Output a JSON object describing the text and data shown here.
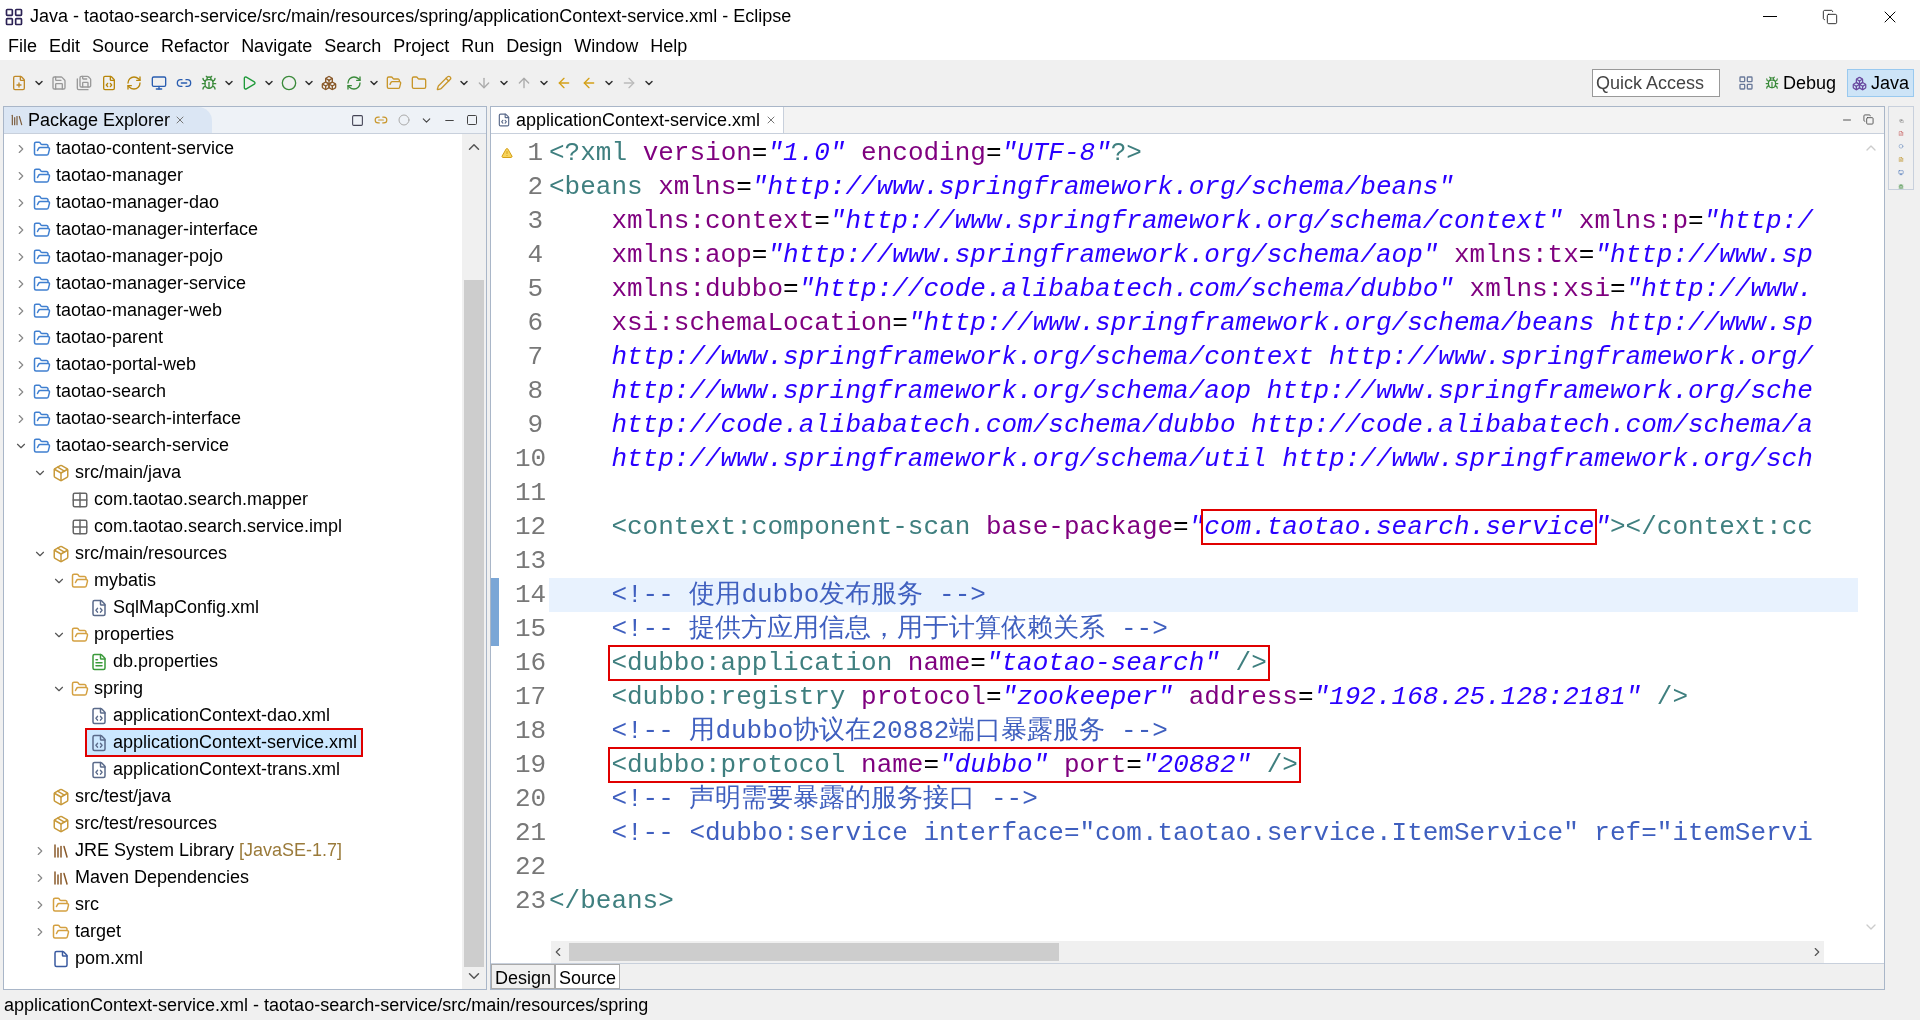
{
  "window": {
    "title": "Java - taotao-search-service/src/main/resources/spring/applicationContext-service.xml - Eclipse"
  },
  "menu": [
    "File",
    "Edit",
    "Source",
    "Refactor",
    "Navigate",
    "Search",
    "Project",
    "Run",
    "Design",
    "Window",
    "Help"
  ],
  "quick_access": {
    "placeholder": "Quick Access"
  },
  "perspectives": [
    {
      "label": "Debug",
      "selected": false
    },
    {
      "label": "Java",
      "selected": true
    }
  ],
  "package_explorer": {
    "title": "Package Explorer",
    "tree": [
      {
        "label": "taotao-content-service",
        "kind": "project",
        "expanded": false,
        "selected": false
      },
      {
        "label": "taotao-manager",
        "kind": "project",
        "expanded": false,
        "selected": false
      },
      {
        "label": "taotao-manager-dao",
        "kind": "project",
        "expanded": false,
        "selected": false
      },
      {
        "label": "taotao-manager-interface",
        "kind": "project",
        "expanded": false,
        "selected": false
      },
      {
        "label": "taotao-manager-pojo",
        "kind": "project",
        "expanded": false,
        "selected": false
      },
      {
        "label": "taotao-manager-service",
        "kind": "project",
        "expanded": false,
        "selected": false
      },
      {
        "label": "taotao-manager-web",
        "kind": "project",
        "expanded": false,
        "selected": false
      },
      {
        "label": "taotao-parent",
        "kind": "project",
        "expanded": false,
        "selected": false
      },
      {
        "label": "taotao-portal-web",
        "kind": "project",
        "expanded": false,
        "selected": false
      },
      {
        "label": "taotao-search",
        "kind": "project",
        "expanded": false,
        "selected": false
      },
      {
        "label": "taotao-search-interface",
        "kind": "project",
        "expanded": false,
        "selected": false
      },
      {
        "label": "taotao-search-service",
        "kind": "project",
        "expanded": true,
        "selected": false,
        "children": [
          {
            "label": "src/main/java",
            "kind": "sourcefolder",
            "expanded": true,
            "selected": false,
            "children": [
              {
                "label": "com.taotao.search.mapper",
                "kind": "package",
                "selected": false
              },
              {
                "label": "com.taotao.search.service.impl",
                "kind": "package",
                "selected": false
              }
            ]
          },
          {
            "label": "src/main/resources",
            "kind": "sourcefolder",
            "expanded": true,
            "selected": false,
            "children": [
              {
                "label": "mybatis",
                "kind": "folder",
                "expanded": true,
                "selected": false,
                "children": [
                  {
                    "label": "SqlMapConfig.xml",
                    "kind": "xml",
                    "selected": false
                  }
                ]
              },
              {
                "label": "properties",
                "kind": "folder",
                "expanded": true,
                "selected": false,
                "children": [
                  {
                    "label": "db.properties",
                    "kind": "properties",
                    "selected": false
                  }
                ]
              },
              {
                "label": "spring",
                "kind": "folder",
                "expanded": true,
                "selected": false,
                "children": [
                  {
                    "label": "applicationContext-dao.xml",
                    "kind": "xml",
                    "selected": false
                  },
                  {
                    "label": "applicationContext-service.xml",
                    "kind": "xml",
                    "selected": true,
                    "boxed": true
                  },
                  {
                    "label": "applicationContext-trans.xml",
                    "kind": "xml",
                    "selected": false
                  }
                ]
              }
            ]
          },
          {
            "label": "src/test/java",
            "kind": "sourcefolder",
            "selected": false
          },
          {
            "label": "src/test/resources",
            "kind": "sourcefolder",
            "selected": false
          },
          {
            "label": "JRE System Library",
            "detail": "[JavaSE-1.7]",
            "kind": "library",
            "expanded": false,
            "selected": false
          },
          {
            "label": "Maven Dependencies",
            "kind": "library",
            "expanded": false,
            "selected": false
          },
          {
            "label": "src",
            "kind": "folder",
            "expanded": false,
            "selected": false
          },
          {
            "label": "target",
            "kind": "folder",
            "expanded": false,
            "selected": false
          },
          {
            "label": "pom.xml",
            "kind": "pom",
            "selected": false
          }
        ]
      }
    ]
  },
  "editor": {
    "tab": "applicationContext-service.xml",
    "lines": [
      {
        "number": "1",
        "kind": "warning",
        "indented": false,
        "current": false,
        "tokens": [
          {
            "kind": "tag",
            "text": "<?xml "
          },
          {
            "kind": "attr",
            "text": "version"
          },
          {
            "kind": "eq",
            "text": "="
          },
          {
            "kind": "value",
            "text": "\"1.0\" "
          },
          {
            "kind": "attr",
            "text": "encoding"
          },
          {
            "kind": "eq",
            "text": "="
          },
          {
            "kind": "value",
            "text": "\"UTF-8\""
          },
          {
            "kind": "tag",
            "text": "?>"
          }
        ]
      },
      {
        "number": "2",
        "kind": "plain",
        "indented": false,
        "current": false,
        "tokens": [
          {
            "kind": "tag",
            "text": "<beans "
          },
          {
            "kind": "attr",
            "text": "xmlns"
          },
          {
            "kind": "eq",
            "text": "="
          },
          {
            "kind": "value",
            "text": "\"http://www.springframework.org/schema/beans\""
          }
        ]
      },
      {
        "number": "3",
        "kind": "plain",
        "indented": true,
        "current": false,
        "tokens": [
          {
            "kind": "attr",
            "text": "xmlns:context"
          },
          {
            "kind": "eq",
            "text": "="
          },
          {
            "kind": "value",
            "text": "\"http://www.springframework.org/schema/context\" "
          },
          {
            "kind": "attr",
            "text": "xmlns:p"
          },
          {
            "kind": "eq",
            "text": "="
          },
          {
            "kind": "value",
            "text": "\"http:/"
          }
        ]
      },
      {
        "number": "4",
        "kind": "plain",
        "indented": true,
        "current": false,
        "tokens": [
          {
            "kind": "attr",
            "text": "xmlns:aop"
          },
          {
            "kind": "eq",
            "text": "="
          },
          {
            "kind": "value",
            "text": "\"http://www.springframework.org/schema/aop\" "
          },
          {
            "kind": "attr",
            "text": "xmlns:tx"
          },
          {
            "kind": "eq",
            "text": "="
          },
          {
            "kind": "value",
            "text": "\"http://www.sp"
          }
        ]
      },
      {
        "number": "5",
        "kind": "plain",
        "indented": true,
        "current": false,
        "tokens": [
          {
            "kind": "attr",
            "text": "xmlns:dubbo"
          },
          {
            "kind": "eq",
            "text": "="
          },
          {
            "kind": "value",
            "text": "\"http://code.alibabatech.com/schema/dubbo\" "
          },
          {
            "kind": "attr",
            "text": "xmlns:xsi"
          },
          {
            "kind": "eq",
            "text": "="
          },
          {
            "kind": "value",
            "text": "\"http://www."
          }
        ]
      },
      {
        "number": "6",
        "kind": "plain",
        "indented": true,
        "current": false,
        "tokens": [
          {
            "kind": "attr",
            "text": "xsi:schemaLocation"
          },
          {
            "kind": "eq",
            "text": "="
          },
          {
            "kind": "value",
            "text": "\"http://www.springframework.org/schema/beans http://www.sp"
          }
        ]
      },
      {
        "number": "7",
        "kind": "plain",
        "indented": true,
        "current": false,
        "tokens": [
          {
            "kind": "value",
            "text": "http://www.springframework.org/schema/context http://www.springframework.org/"
          }
        ]
      },
      {
        "number": "8",
        "kind": "plain",
        "indented": true,
        "current": false,
        "tokens": [
          {
            "kind": "value",
            "text": "http://www.springframework.org/schema/aop http://www.springframework.org/sche"
          }
        ]
      },
      {
        "number": "9",
        "kind": "plain",
        "indented": true,
        "current": false,
        "tokens": [
          {
            "kind": "value",
            "text": "http://code.alibabatech.com/schema/dubbo http://code.alibabatech.com/schema/a"
          }
        ]
      },
      {
        "number": "10",
        "kind": "plain",
        "indented": true,
        "current": false,
        "tokens": [
          {
            "kind": "value",
            "text": "http://www.springframework.org/schema/util http://www.springframework.org/sch"
          }
        ]
      },
      {
        "number": "11",
        "kind": "plain",
        "current": false
      },
      {
        "number": "12",
        "kind": "plain",
        "indented": true,
        "current": false,
        "tokens": [
          {
            "kind": "tag",
            "text": "<context:component-scan "
          },
          {
            "kind": "attr",
            "text": "base-package"
          },
          {
            "kind": "eq",
            "text": "="
          },
          {
            "kind": "value",
            "text": "\""
          }
        ],
        "highlighted": [
          {
            "kind": "value",
            "text": "com.taotao.search.service"
          }
        ],
        "tokens_after": [
          {
            "kind": "value",
            "text": "\""
          },
          {
            "kind": "tag",
            "text": "></context:cc"
          }
        ]
      },
      {
        "number": "13",
        "kind": "plain",
        "current": false
      },
      {
        "number": "14",
        "kind": "changed",
        "indented": true,
        "current": true,
        "tokens": [
          {
            "kind": "comment",
            "text": "<!-- 使用dubbo发布服务 -->"
          }
        ]
      },
      {
        "number": "15",
        "kind": "changed",
        "indented": true,
        "current": false,
        "tokens": [
          {
            "kind": "comment",
            "text": "<!-- 提供方应用信息，用于计算依赖关系 -->"
          }
        ]
      },
      {
        "number": "16",
        "kind": "plain",
        "indented": true,
        "current": false,
        "highlighted": [
          {
            "kind": "tag",
            "text": "<dubbo:application "
          },
          {
            "kind": "attr",
            "text": "name"
          },
          {
            "kind": "eq",
            "text": "="
          },
          {
            "kind": "value",
            "text": "\"taotao-search\" "
          },
          {
            "kind": "tag",
            "text": "/>"
          }
        ]
      },
      {
        "number": "17",
        "kind": "plain",
        "indented": true,
        "current": false,
        "tokens": [
          {
            "kind": "tag",
            "text": "<dubbo:registry "
          },
          {
            "kind": "attr",
            "text": "protocol"
          },
          {
            "kind": "eq",
            "text": "="
          },
          {
            "kind": "value",
            "text": "\"zookeeper\" "
          },
          {
            "kind": "attr",
            "text": "address"
          },
          {
            "kind": "eq",
            "text": "="
          },
          {
            "kind": "value",
            "text": "\"192.168.25.128:2181\" "
          },
          {
            "kind": "tag",
            "text": "/>"
          }
        ]
      },
      {
        "number": "18",
        "kind": "plain",
        "indented": true,
        "current": false,
        "tokens": [
          {
            "kind": "comment",
            "text": "<!-- 用dubbo协议在20882端口暴露服务 -->"
          }
        ]
      },
      {
        "number": "19",
        "kind": "plain",
        "indented": true,
        "current": false,
        "highlighted": [
          {
            "kind": "tag",
            "text": "<dubbo:protocol "
          },
          {
            "kind": "attr",
            "text": "name"
          },
          {
            "kind": "eq",
            "text": "="
          },
          {
            "kind": "value",
            "text": "\"dubbo\" "
          },
          {
            "kind": "attr",
            "text": "port"
          },
          {
            "kind": "eq",
            "text": "="
          },
          {
            "kind": "value",
            "text": "\"20882\" "
          },
          {
            "kind": "tag",
            "text": "/>"
          }
        ]
      },
      {
        "number": "20",
        "kind": "plain",
        "indented": true,
        "current": false,
        "tokens": [
          {
            "kind": "comment",
            "text": "<!-- 声明需要暴露的服务接口 -->"
          }
        ]
      },
      {
        "number": "21",
        "kind": "plain",
        "indented": true,
        "current": false,
        "tokens": [
          {
            "kind": "comment",
            "text": "<!-- <dubbo:service interface=\"com.taotao.service.ItemService\" ref=\"itemServi"
          }
        ]
      },
      {
        "number": "22",
        "kind": "plain",
        "current": false
      },
      {
        "number": "23",
        "kind": "plain",
        "indented": false,
        "current": false,
        "tokens": [
          {
            "kind": "tag",
            "text": "</beans>"
          }
        ]
      }
    ],
    "bottom_tabs": [
      {
        "label": "Design",
        "selected": false
      },
      {
        "label": "Source",
        "selected": true
      }
    ]
  },
  "status_bar": "applicationContext-service.xml - taotao-search-service/src/main/resources/spring"
}
